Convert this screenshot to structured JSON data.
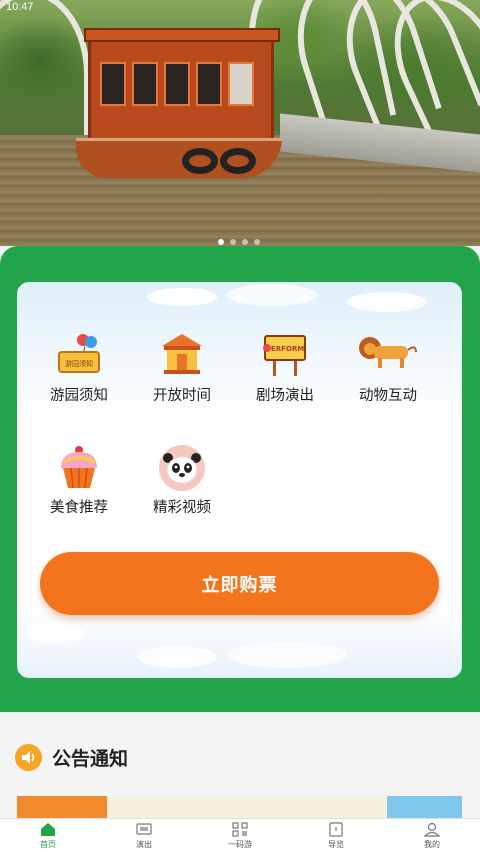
{
  "status_bar": {
    "time": "10:47"
  },
  "banner": {
    "slide_count": 4,
    "active_slide": 1
  },
  "grid": {
    "items": [
      {
        "label": "游园须知",
        "icon": "park-notice-icon",
        "badge_text": "游园须知"
      },
      {
        "label": "开放时间",
        "icon": "pavilion-icon"
      },
      {
        "label": "剧场演出",
        "icon": "perform-sign-icon",
        "sign_text": "PERFORM"
      },
      {
        "label": "动物互动",
        "icon": "lion-icon"
      },
      {
        "label": "美食推荐",
        "icon": "cupcake-icon"
      },
      {
        "label": "精彩视频",
        "icon": "panda-icon"
      }
    ]
  },
  "buy_button": {
    "label": "立即购票"
  },
  "notice": {
    "title": "公告通知"
  },
  "bottom_nav": {
    "items": [
      {
        "label": "首页",
        "icon": "home-icon",
        "active": true
      },
      {
        "label": "演出",
        "icon": "tv-icon",
        "active": false
      },
      {
        "label": "一码游",
        "icon": "qr-code-icon",
        "active": false
      },
      {
        "label": "导览",
        "icon": "map-icon",
        "active": false
      },
      {
        "label": "我的",
        "icon": "user-icon",
        "active": false
      }
    ]
  },
  "colors": {
    "brand_green": "#21a44a",
    "accent_orange": "#f4741e",
    "speaker_orange": "#f5a623"
  }
}
